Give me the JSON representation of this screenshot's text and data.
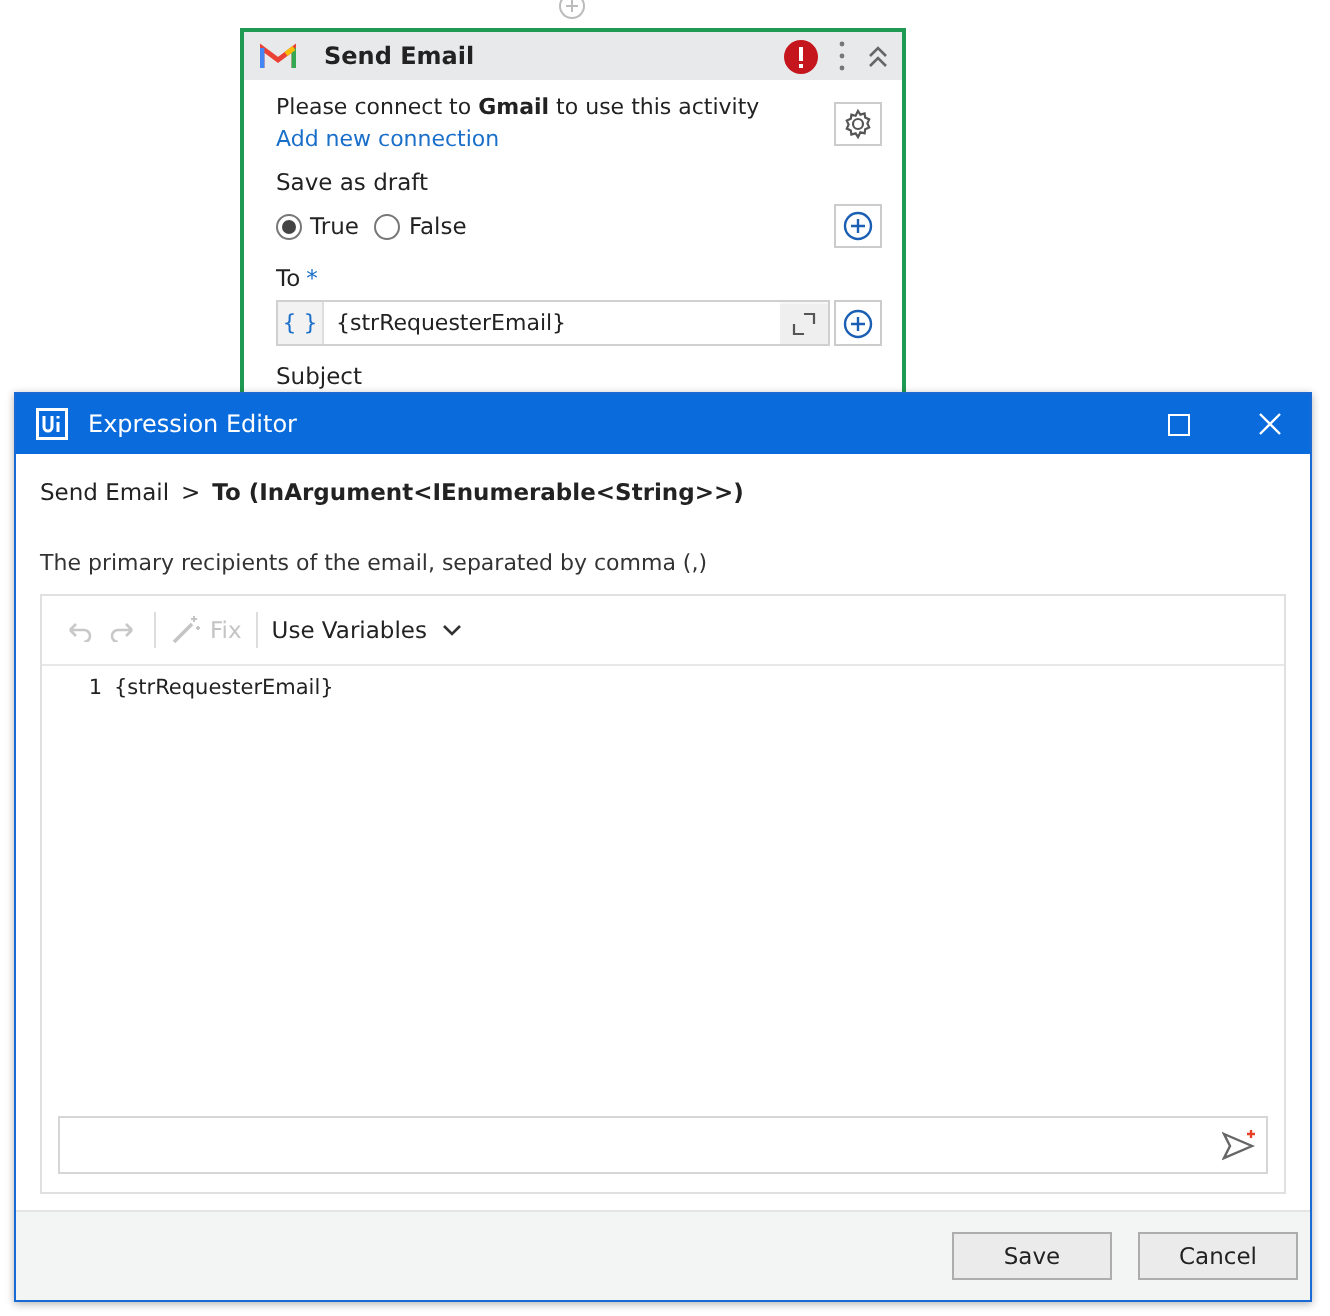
{
  "activity": {
    "title": "Send Email",
    "error": true,
    "message": "Please connect to **Gmail** to use this activity",
    "link": "Add new connection",
    "save_as_draft": {
      "label": "Save as draft",
      "options": [
        {
          "label": "True",
          "selected": true
        },
        {
          "label": "False",
          "selected": false
        }
      ]
    },
    "to": {
      "label": "To",
      "required_mark": "*",
      "prefix": "{ }",
      "value": "{strRequesterEmail}"
    },
    "next_label": "Subject"
  },
  "dialog": {
    "title": "Expression Editor",
    "breadcrumb": {
      "parent": "Send Email",
      "separator": ">",
      "current": "To (InArgument<IEnumerable<String>>)"
    },
    "description": "The primary recipients of the email, separated by comma (,)",
    "toolbar": {
      "fix": {
        "label": "Fix",
        "disabled": true
      },
      "variables": "Use Variables"
    },
    "lines": [
      {
        "number": "1",
        "text": "{strRequesterEmail}"
      }
    ],
    "buttons": [
      "Save",
      "Cancel"
    ]
  }
}
